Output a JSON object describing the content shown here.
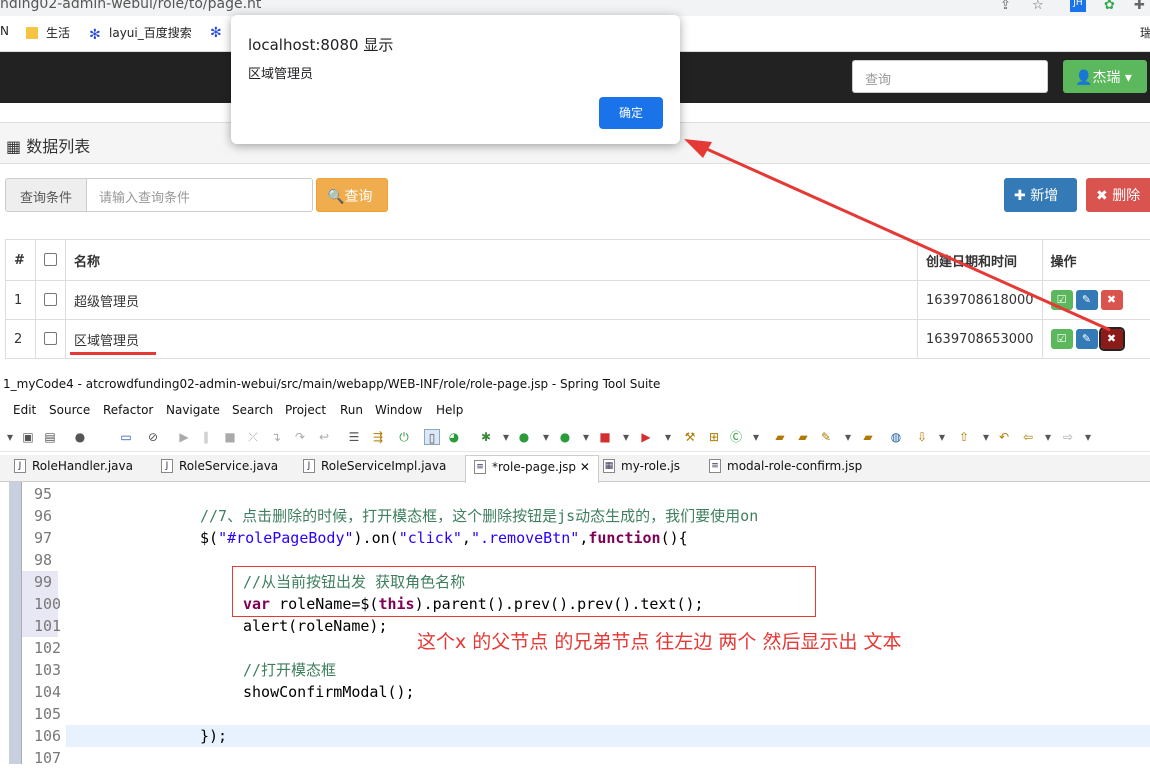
{
  "browser": {
    "url": "nding02-admin-webui/role/to/page.ht",
    "bookmarks": [
      {
        "label": "N",
        "icon": "none"
      },
      {
        "label": "生活",
        "icon": "folder-icon"
      },
      {
        "label": "layui_百度搜索",
        "icon": "baidu-paw-icon"
      },
      {
        "label": "",
        "icon": "baidu-paw-icon"
      }
    ],
    "right_overflow": "瑞"
  },
  "app": {
    "search_placeholder": "查询",
    "user_label": "杰瑞",
    "panel_title": "数据列表",
    "cond_label": "查询条件",
    "cond_placeholder": "请输入查询条件",
    "query_btn": "查询",
    "add_btn": "新增",
    "delete_btn": "删除",
    "table": {
      "headers": [
        "#",
        "",
        "名称",
        "创建日期和时间",
        "操作"
      ],
      "rows": [
        {
          "num": "1",
          "name": "超级管理员",
          "date": "1639708618000"
        },
        {
          "num": "2",
          "name": "区域管理员",
          "date": "1639708653000"
        }
      ]
    }
  },
  "alert": {
    "title": "localhost:8080 显示",
    "message": "区域管理员",
    "ok": "确定"
  },
  "ide": {
    "title": "1_myCode4 - atcrowdfunding02-admin-webui/src/main/webapp/WEB-INF/role/role-page.jsp - Spring Tool Suite",
    "menu": [
      "Edit",
      "Source",
      "Refactor",
      "Navigate",
      "Search",
      "Project",
      "Run",
      "Window",
      "Help"
    ],
    "tabs": [
      "RoleHandler.java",
      "RoleService.java",
      "RoleServiceImpl.java",
      "*role-page.jsp",
      "my-role.js",
      "modal-role-confirm.jsp"
    ],
    "line_numbers": [
      "95",
      "96",
      "97",
      "98",
      "99",
      "100",
      "101",
      "102",
      "103",
      "104",
      "105",
      "106",
      "107"
    ],
    "code": {
      "c96": "//7、点击删除的时候，打开模态框，这个删除按钮是js动态生成的，我们要使用on",
      "c97a": "$(",
      "c97b": "\"#rolePageBody\"",
      "c97c": ").on(",
      "c97d": "\"click\"",
      "c97e": ",",
      "c97f": "\".removeBtn\"",
      "c97g": ",",
      "c97h": "function",
      "c97i": "(){",
      "c99": "//从当前按钮出发 获取角色名称",
      "c100a": "var",
      "c100b": " roleName=$(",
      "c100c": "this",
      "c100d": ").parent().prev().prev().text();",
      "c101": "alert(roleName);",
      "c103": "//打开模态框",
      "c104": "showConfirmModal();",
      "c106": "});"
    },
    "annotation": "这个x 的父节点  的兄弟节点 往左边  两个  然后显示出 文本"
  },
  "colors": {
    "annotation_red": "#e53935",
    "primary": "#337ab7",
    "success": "#5cb85c",
    "danger": "#d9534f",
    "warning": "#f0ad4e"
  }
}
